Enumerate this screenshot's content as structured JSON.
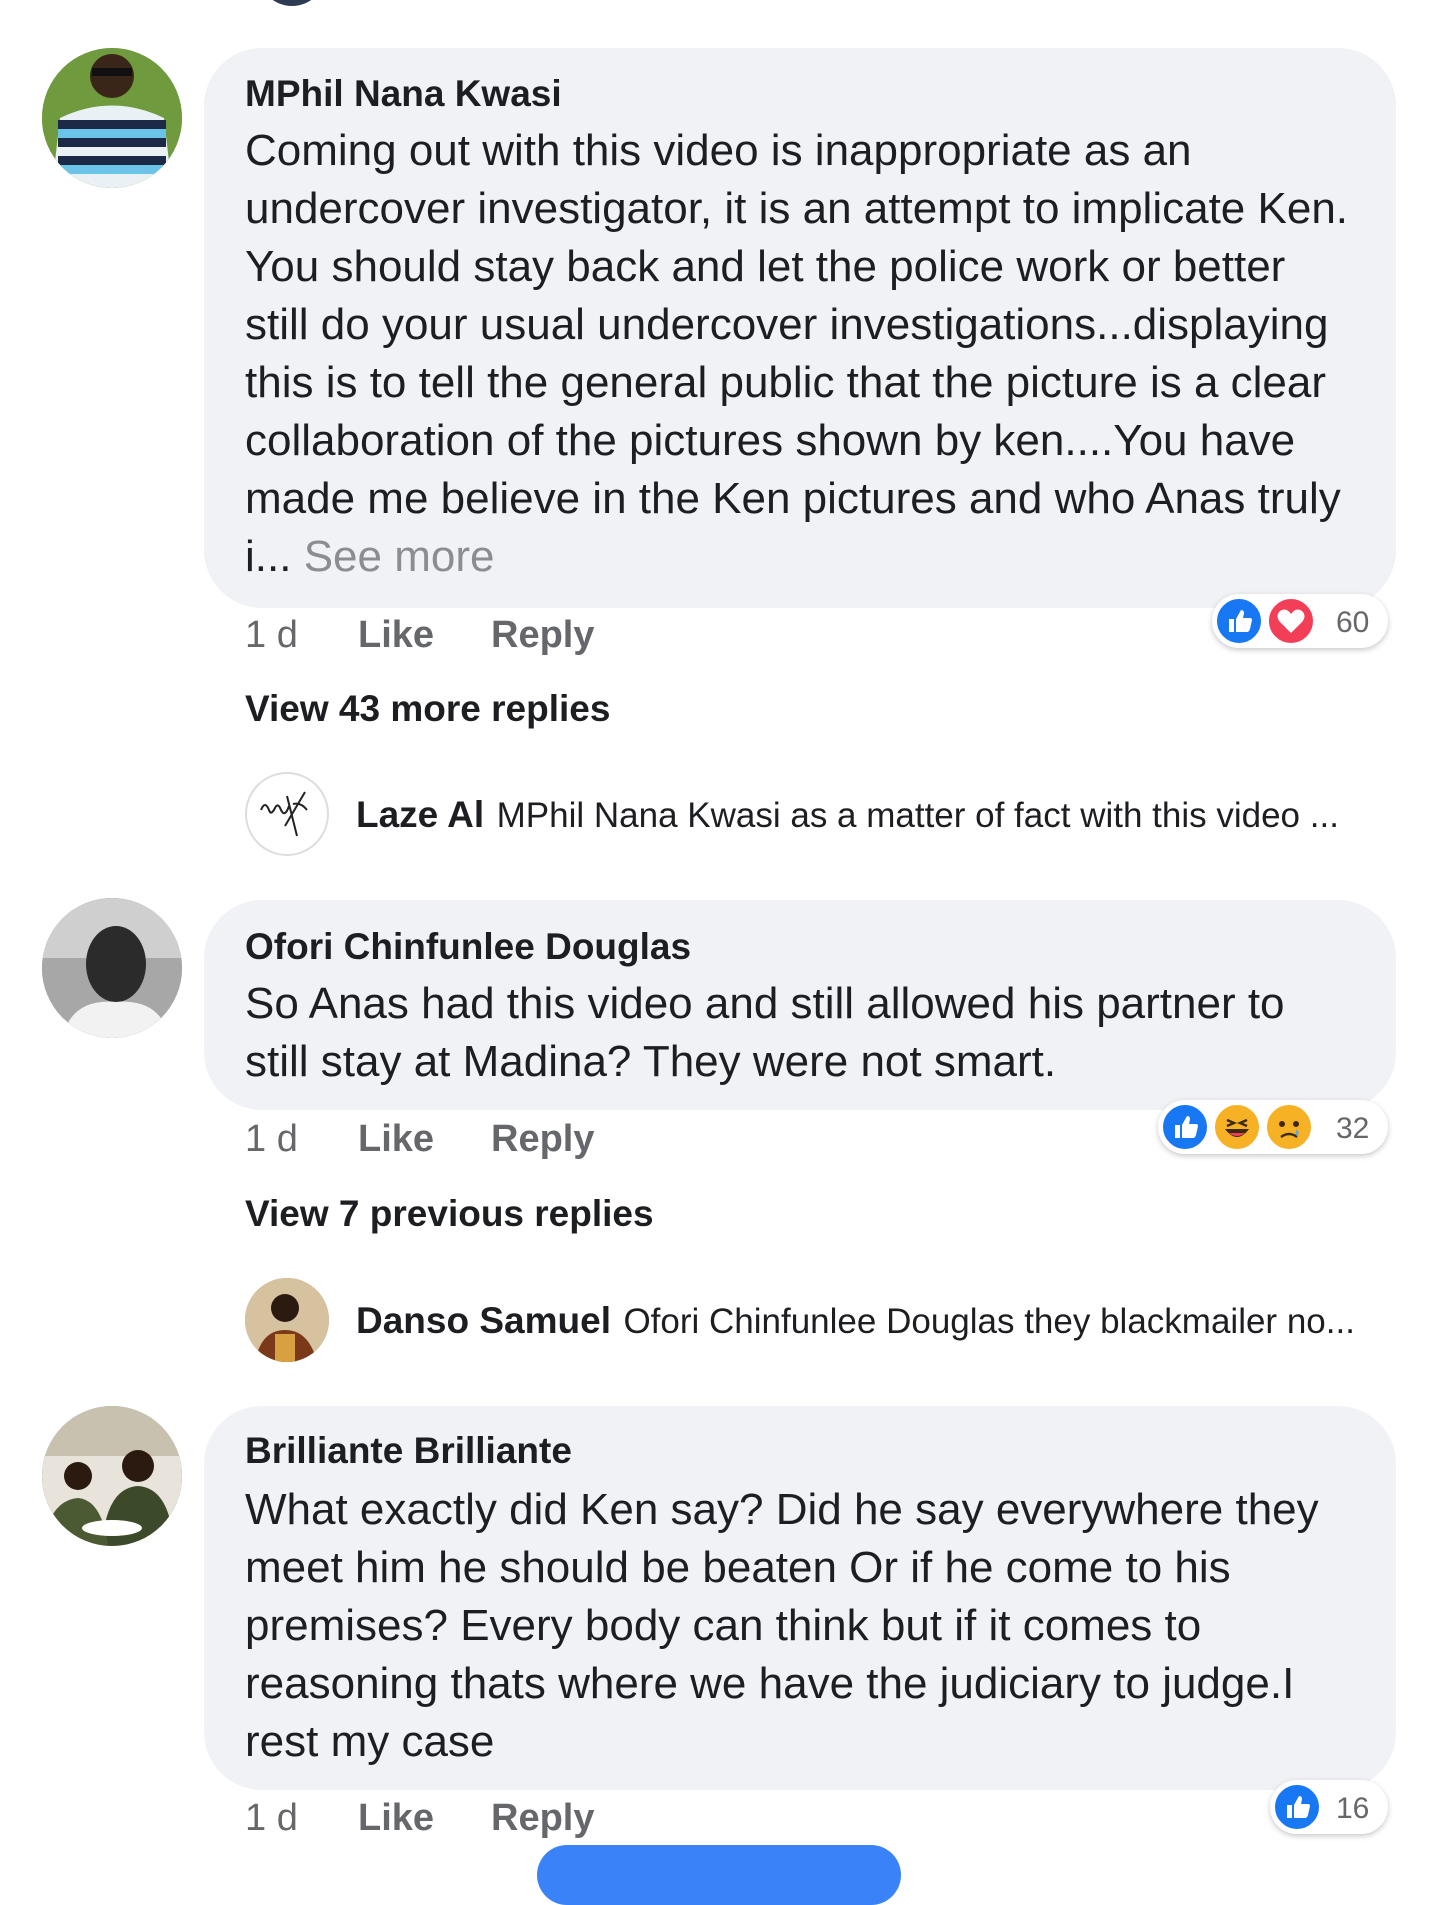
{
  "comments": [
    {
      "author": "MPhil Nana Kwasi",
      "text": "Coming out with this video is inappropriate as an undercover investigator, it is an attempt to implicate Ken. You should stay back and let the police  work or better still do your usual undercover investigations...displaying this is to tell the general public that the picture is a clear collaboration of the pictures shown by ken....You have made me believe in the Ken pictures and who Anas truly i...",
      "see_more": "See more",
      "time": "1 d",
      "like": "Like",
      "reply": "Reply",
      "reaction_count": "60",
      "reactions": [
        "like-icon",
        "love-icon"
      ],
      "view_replies": "View 43 more replies",
      "preview_reply": {
        "author": "Laze Al",
        "text": "MPhil Nana Kwasi as a matter of fact with this video ..."
      }
    },
    {
      "author": "Ofori Chinfunlee Douglas",
      "text": "So Anas had this video and still allowed his partner to still stay at Madina? They were not smart.",
      "time": "1 d",
      "like": "Like",
      "reply": "Reply",
      "reaction_count": "32",
      "reactions": [
        "like-icon",
        "haha-icon",
        "sad-icon"
      ],
      "view_replies": "View 7 previous replies",
      "preview_reply": {
        "author": "Danso Samuel",
        "text": "Ofori Chinfunlee Douglas  they blackmailer no..."
      }
    },
    {
      "author": "Brilliante Brilliante",
      "text": "What exactly did Ken say? Did he say everywhere they meet him he should be beaten Or if he come to his premises? Every body can think but if it comes to reasoning thats where we have the judiciary to judge.I rest my case",
      "time": "1 d",
      "like": "Like",
      "reply": "Reply",
      "reaction_count": "16",
      "reactions": [
        "like-icon"
      ]
    }
  ],
  "colors": {
    "bubble": "#f0f2f5",
    "like_blue": "#1877f2",
    "love_red": "#f33e58",
    "haha_yellow": "#f7b125",
    "meta_gray": "#65676b"
  }
}
